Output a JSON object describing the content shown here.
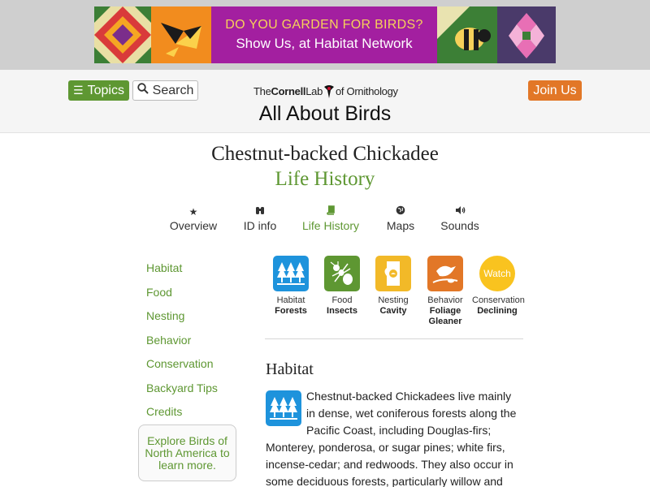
{
  "ad": {
    "line1": "DO YOU GARDEN FOR BIRDS?",
    "line2": "Show Us, at Habitat Network"
  },
  "header": {
    "topics_label": "Topics",
    "search_label": "Search",
    "join_label": "Join Us",
    "logo_the": "The",
    "logo_cornell": "Cornell",
    "logo_lab": "Lab",
    "logo_of": "of Ornithology",
    "site_title": "All About Birds"
  },
  "page": {
    "species": "Chestnut-backed Chickadee",
    "subtitle": "Life History"
  },
  "tabs": [
    {
      "label": "Overview",
      "icon": "star-icon",
      "glyph": "★"
    },
    {
      "label": "ID info",
      "icon": "binoculars-icon",
      "glyph": "⛯"
    },
    {
      "label": "Life History",
      "icon": "book-icon",
      "glyph": "▮"
    },
    {
      "label": "Maps",
      "icon": "globe-icon",
      "glyph": "◉"
    },
    {
      "label": "Sounds",
      "icon": "speaker-icon",
      "glyph": "◀)"
    }
  ],
  "sidebar": {
    "items": [
      "Habitat",
      "Food",
      "Nesting",
      "Behavior",
      "Conservation",
      "Backyard Tips",
      "Credits"
    ],
    "explore": "Explore Birds of North America to learn more."
  },
  "summary": [
    {
      "category": "Habitat",
      "value": "Forests",
      "icon": "forest-icon",
      "color": "#1e93dc"
    },
    {
      "category": "Food",
      "value": "Insects",
      "icon": "ant-icon",
      "color": "#5e9732"
    },
    {
      "category": "Nesting",
      "value": "Cavity",
      "icon": "cavity-icon",
      "color": "#f2b928"
    },
    {
      "category": "Behavior",
      "value": "Foliage Gleaner",
      "icon": "gleaner-bird-icon",
      "color": "#e27727"
    },
    {
      "category": "Conservation",
      "value": "Declining",
      "badge": "Watch",
      "icon": "watch-badge-icon",
      "color": "#f9c31f"
    }
  ],
  "section": {
    "title": "Habitat",
    "text": "Chestnut-backed Chickadees live mainly in dense, wet coniferous forests along the Pacific Coast, including Douglas-firs; Monterey, ponderosa, or sugar pines; white firs, incense-cedar; and redwoods. They also occur in some deciduous forests, particularly willow and alder"
  },
  "colors": {
    "accent_green": "#5e9732",
    "join_orange": "#e27727",
    "ad_purple": "#a31fa0"
  }
}
